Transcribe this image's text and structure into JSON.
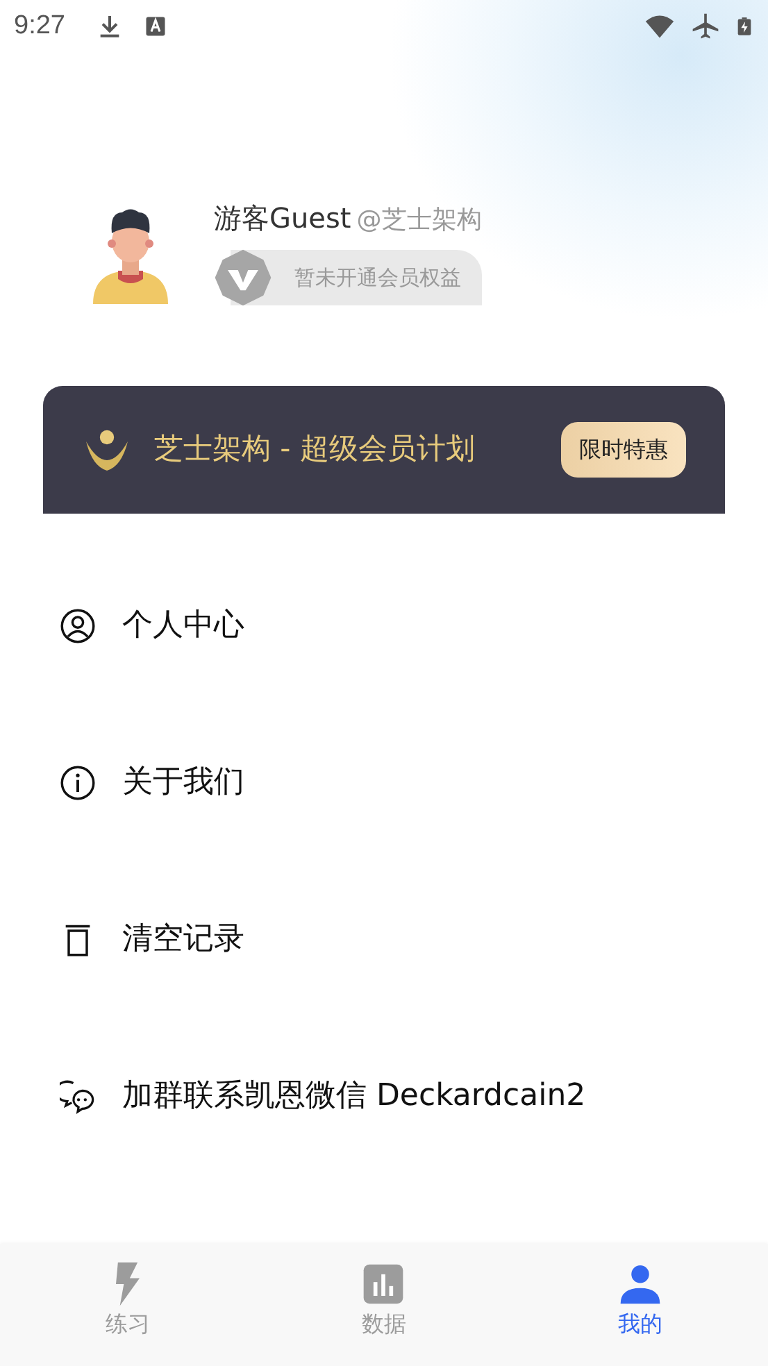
{
  "status_bar": {
    "time": "9:27"
  },
  "profile": {
    "name": "游客Guest",
    "handle": "@芝士架构",
    "membership": "暂未开通会员权益"
  },
  "banner": {
    "title": "芝士架构 - 超级会员计划",
    "button": "限时特惠"
  },
  "menu": [
    {
      "label": "个人中心",
      "kind": "person"
    },
    {
      "label": "关于我们",
      "kind": "info"
    },
    {
      "label": "清空记录",
      "kind": "trash"
    },
    {
      "label": "加群联系凯恩微信 Deckardcain2",
      "kind": "chat"
    }
  ],
  "tabs": [
    {
      "label": "练习",
      "kind": "bolt",
      "selected": false
    },
    {
      "label": "数据",
      "kind": "chart",
      "selected": false
    },
    {
      "label": "我的",
      "kind": "user",
      "selected": true
    }
  ]
}
